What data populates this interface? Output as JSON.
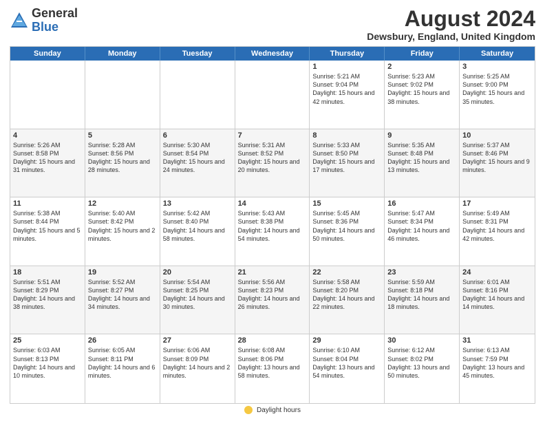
{
  "header": {
    "logo_general": "General",
    "logo_blue": "Blue",
    "month_year": "August 2024",
    "location": "Dewsbury, England, United Kingdom"
  },
  "weekdays": [
    "Sunday",
    "Monday",
    "Tuesday",
    "Wednesday",
    "Thursday",
    "Friday",
    "Saturday"
  ],
  "rows": [
    [
      {
        "day": "",
        "info": ""
      },
      {
        "day": "",
        "info": ""
      },
      {
        "day": "",
        "info": ""
      },
      {
        "day": "",
        "info": ""
      },
      {
        "day": "1",
        "info": "Sunrise: 5:21 AM\nSunset: 9:04 PM\nDaylight: 15 hours\nand 42 minutes."
      },
      {
        "day": "2",
        "info": "Sunrise: 5:23 AM\nSunset: 9:02 PM\nDaylight: 15 hours\nand 38 minutes."
      },
      {
        "day": "3",
        "info": "Sunrise: 5:25 AM\nSunset: 9:00 PM\nDaylight: 15 hours\nand 35 minutes."
      }
    ],
    [
      {
        "day": "4",
        "info": "Sunrise: 5:26 AM\nSunset: 8:58 PM\nDaylight: 15 hours\nand 31 minutes."
      },
      {
        "day": "5",
        "info": "Sunrise: 5:28 AM\nSunset: 8:56 PM\nDaylight: 15 hours\nand 28 minutes."
      },
      {
        "day": "6",
        "info": "Sunrise: 5:30 AM\nSunset: 8:54 PM\nDaylight: 15 hours\nand 24 minutes."
      },
      {
        "day": "7",
        "info": "Sunrise: 5:31 AM\nSunset: 8:52 PM\nDaylight: 15 hours\nand 20 minutes."
      },
      {
        "day": "8",
        "info": "Sunrise: 5:33 AM\nSunset: 8:50 PM\nDaylight: 15 hours\nand 17 minutes."
      },
      {
        "day": "9",
        "info": "Sunrise: 5:35 AM\nSunset: 8:48 PM\nDaylight: 15 hours\nand 13 minutes."
      },
      {
        "day": "10",
        "info": "Sunrise: 5:37 AM\nSunset: 8:46 PM\nDaylight: 15 hours\nand 9 minutes."
      }
    ],
    [
      {
        "day": "11",
        "info": "Sunrise: 5:38 AM\nSunset: 8:44 PM\nDaylight: 15 hours\nand 5 minutes."
      },
      {
        "day": "12",
        "info": "Sunrise: 5:40 AM\nSunset: 8:42 PM\nDaylight: 15 hours\nand 2 minutes."
      },
      {
        "day": "13",
        "info": "Sunrise: 5:42 AM\nSunset: 8:40 PM\nDaylight: 14 hours\nand 58 minutes."
      },
      {
        "day": "14",
        "info": "Sunrise: 5:43 AM\nSunset: 8:38 PM\nDaylight: 14 hours\nand 54 minutes."
      },
      {
        "day": "15",
        "info": "Sunrise: 5:45 AM\nSunset: 8:36 PM\nDaylight: 14 hours\nand 50 minutes."
      },
      {
        "day": "16",
        "info": "Sunrise: 5:47 AM\nSunset: 8:34 PM\nDaylight: 14 hours\nand 46 minutes."
      },
      {
        "day": "17",
        "info": "Sunrise: 5:49 AM\nSunset: 8:31 PM\nDaylight: 14 hours\nand 42 minutes."
      }
    ],
    [
      {
        "day": "18",
        "info": "Sunrise: 5:51 AM\nSunset: 8:29 PM\nDaylight: 14 hours\nand 38 minutes."
      },
      {
        "day": "19",
        "info": "Sunrise: 5:52 AM\nSunset: 8:27 PM\nDaylight: 14 hours\nand 34 minutes."
      },
      {
        "day": "20",
        "info": "Sunrise: 5:54 AM\nSunset: 8:25 PM\nDaylight: 14 hours\nand 30 minutes."
      },
      {
        "day": "21",
        "info": "Sunrise: 5:56 AM\nSunset: 8:23 PM\nDaylight: 14 hours\nand 26 minutes."
      },
      {
        "day": "22",
        "info": "Sunrise: 5:58 AM\nSunset: 8:20 PM\nDaylight: 14 hours\nand 22 minutes."
      },
      {
        "day": "23",
        "info": "Sunrise: 5:59 AM\nSunset: 8:18 PM\nDaylight: 14 hours\nand 18 minutes."
      },
      {
        "day": "24",
        "info": "Sunrise: 6:01 AM\nSunset: 8:16 PM\nDaylight: 14 hours\nand 14 minutes."
      }
    ],
    [
      {
        "day": "25",
        "info": "Sunrise: 6:03 AM\nSunset: 8:13 PM\nDaylight: 14 hours\nand 10 minutes."
      },
      {
        "day": "26",
        "info": "Sunrise: 6:05 AM\nSunset: 8:11 PM\nDaylight: 14 hours\nand 6 minutes."
      },
      {
        "day": "27",
        "info": "Sunrise: 6:06 AM\nSunset: 8:09 PM\nDaylight: 14 hours\nand 2 minutes."
      },
      {
        "day": "28",
        "info": "Sunrise: 6:08 AM\nSunset: 8:06 PM\nDaylight: 13 hours\nand 58 minutes."
      },
      {
        "day": "29",
        "info": "Sunrise: 6:10 AM\nSunset: 8:04 PM\nDaylight: 13 hours\nand 54 minutes."
      },
      {
        "day": "30",
        "info": "Sunrise: 6:12 AM\nSunset: 8:02 PM\nDaylight: 13 hours\nand 50 minutes."
      },
      {
        "day": "31",
        "info": "Sunrise: 6:13 AM\nSunset: 7:59 PM\nDaylight: 13 hours\nand 45 minutes."
      }
    ]
  ],
  "footer": {
    "legend_label": "Daylight hours"
  }
}
